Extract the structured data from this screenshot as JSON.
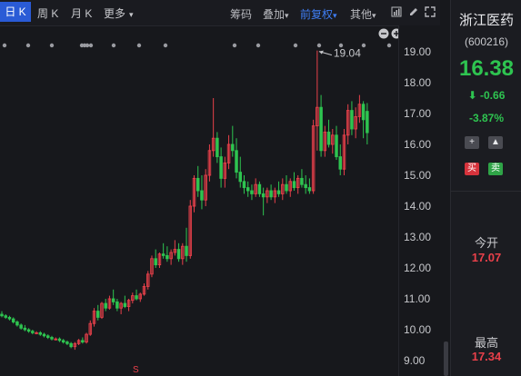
{
  "periods": [
    {
      "label": "日 K"
    },
    {
      "label": "周 K"
    },
    {
      "label": "月 K"
    },
    {
      "label": "更多"
    }
  ],
  "toolbar": {
    "chips": "筹码",
    "overlay": "叠加",
    "adjust": "前复权",
    "other": "其他"
  },
  "annotations": {
    "peak_label": "19.04",
    "marker": "S"
  },
  "stock": {
    "name": "浙江医药",
    "code": "(600216)",
    "price": "16.38",
    "change": "-0.66",
    "change_pct": "-3.87%",
    "buy_label": "买",
    "sell_label": "卖",
    "stats": [
      {
        "label": "今开",
        "value": "17.07"
      },
      {
        "label": "最高",
        "value": "17.34"
      }
    ]
  },
  "colors": {
    "up": "#e8404a",
    "down": "#2ec450",
    "accent": "#2a5bd6",
    "background": "#17181c"
  },
  "chart_data": {
    "type": "candlestick",
    "y_ticks": [
      "19.00",
      "18.00",
      "17.00",
      "16.00",
      "15.00",
      "14.00",
      "13.00",
      "12.00",
      "11.00",
      "10.00",
      "9.00"
    ],
    "ylim": [
      8.9,
      19.2
    ],
    "candles": [
      {
        "o": 10.5,
        "h": 10.6,
        "l": 10.4,
        "c": 10.45
      },
      {
        "o": 10.45,
        "h": 10.5,
        "l": 10.35,
        "c": 10.4
      },
      {
        "o": 10.4,
        "h": 10.45,
        "l": 10.3,
        "c": 10.35
      },
      {
        "o": 10.35,
        "h": 10.4,
        "l": 10.2,
        "c": 10.25
      },
      {
        "o": 10.25,
        "h": 10.3,
        "l": 10.1,
        "c": 10.15
      },
      {
        "o": 10.15,
        "h": 10.2,
        "l": 10.0,
        "c": 10.05
      },
      {
        "o": 10.05,
        "h": 10.15,
        "l": 9.95,
        "c": 10.0
      },
      {
        "o": 10.0,
        "h": 10.05,
        "l": 9.9,
        "c": 9.95
      },
      {
        "o": 9.95,
        "h": 10.0,
        "l": 9.85,
        "c": 9.9
      },
      {
        "o": 9.9,
        "h": 9.95,
        "l": 9.85,
        "c": 9.9
      },
      {
        "o": 9.9,
        "h": 9.95,
        "l": 9.8,
        "c": 9.85
      },
      {
        "o": 9.85,
        "h": 9.9,
        "l": 9.75,
        "c": 9.8
      },
      {
        "o": 9.8,
        "h": 9.85,
        "l": 9.7,
        "c": 9.75
      },
      {
        "o": 9.75,
        "h": 9.8,
        "l": 9.65,
        "c": 9.7
      },
      {
        "o": 9.7,
        "h": 9.75,
        "l": 9.65,
        "c": 9.7
      },
      {
        "o": 9.7,
        "h": 9.75,
        "l": 9.6,
        "c": 9.65
      },
      {
        "o": 9.65,
        "h": 9.7,
        "l": 9.55,
        "c": 9.6
      },
      {
        "o": 9.6,
        "h": 9.65,
        "l": 9.5,
        "c": 9.55
      },
      {
        "o": 9.55,
        "h": 9.6,
        "l": 9.4,
        "c": 9.45
      },
      {
        "o": 9.45,
        "h": 9.6,
        "l": 9.35,
        "c": 9.55
      },
      {
        "o": 9.55,
        "h": 9.7,
        "l": 9.5,
        "c": 9.65
      },
      {
        "o": 9.65,
        "h": 9.75,
        "l": 9.55,
        "c": 9.6
      },
      {
        "o": 9.6,
        "h": 9.9,
        "l": 9.55,
        "c": 9.85
      },
      {
        "o": 9.85,
        "h": 10.3,
        "l": 9.8,
        "c": 10.2
      },
      {
        "o": 10.2,
        "h": 10.7,
        "l": 10.1,
        "c": 10.6
      },
      {
        "o": 10.6,
        "h": 10.8,
        "l": 10.3,
        "c": 10.4
      },
      {
        "o": 10.4,
        "h": 10.9,
        "l": 10.35,
        "c": 10.85
      },
      {
        "o": 10.85,
        "h": 11.0,
        "l": 10.6,
        "c": 10.7
      },
      {
        "o": 10.7,
        "h": 11.1,
        "l": 10.65,
        "c": 11.0
      },
      {
        "o": 11.0,
        "h": 11.3,
        "l": 10.8,
        "c": 10.9
      },
      {
        "o": 10.9,
        "h": 11.0,
        "l": 10.6,
        "c": 10.7
      },
      {
        "o": 10.7,
        "h": 10.9,
        "l": 10.5,
        "c": 10.85
      },
      {
        "o": 10.85,
        "h": 11.1,
        "l": 10.7,
        "c": 10.75
      },
      {
        "o": 10.75,
        "h": 11.0,
        "l": 10.6,
        "c": 10.95
      },
      {
        "o": 10.95,
        "h": 11.2,
        "l": 10.85,
        "c": 11.1
      },
      {
        "o": 11.1,
        "h": 11.3,
        "l": 10.95,
        "c": 11.0
      },
      {
        "o": 11.0,
        "h": 11.2,
        "l": 10.9,
        "c": 11.15
      },
      {
        "o": 11.15,
        "h": 11.5,
        "l": 11.1,
        "c": 11.4
      },
      {
        "o": 11.4,
        "h": 11.9,
        "l": 11.3,
        "c": 11.8
      },
      {
        "o": 11.8,
        "h": 12.4,
        "l": 11.7,
        "c": 12.3
      },
      {
        "o": 12.3,
        "h": 12.6,
        "l": 12.0,
        "c": 12.1
      },
      {
        "o": 12.1,
        "h": 12.5,
        "l": 12.0,
        "c": 12.45
      },
      {
        "o": 12.45,
        "h": 12.8,
        "l": 12.3,
        "c": 12.4
      },
      {
        "o": 12.4,
        "h": 12.7,
        "l": 12.2,
        "c": 12.3
      },
      {
        "o": 12.3,
        "h": 12.6,
        "l": 12.1,
        "c": 12.5
      },
      {
        "o": 12.5,
        "h": 12.9,
        "l": 12.4,
        "c": 12.6
      },
      {
        "o": 12.6,
        "h": 12.8,
        "l": 12.2,
        "c": 12.3
      },
      {
        "o": 12.3,
        "h": 12.8,
        "l": 12.1,
        "c": 12.7
      },
      {
        "o": 12.7,
        "h": 13.3,
        "l": 12.2,
        "c": 12.4
      },
      {
        "o": 12.4,
        "h": 14.2,
        "l": 12.3,
        "c": 14.0
      },
      {
        "o": 14.0,
        "h": 15.0,
        "l": 13.8,
        "c": 14.9
      },
      {
        "o": 14.9,
        "h": 15.3,
        "l": 14.3,
        "c": 14.5
      },
      {
        "o": 14.5,
        "h": 15.0,
        "l": 13.9,
        "c": 14.2
      },
      {
        "o": 14.2,
        "h": 15.2,
        "l": 14.0,
        "c": 15.0
      },
      {
        "o": 15.0,
        "h": 16.0,
        "l": 14.8,
        "c": 15.8
      },
      {
        "o": 15.8,
        "h": 17.5,
        "l": 15.6,
        "c": 16.2
      },
      {
        "o": 16.2,
        "h": 16.4,
        "l": 15.4,
        "c": 15.6
      },
      {
        "o": 15.6,
        "h": 15.9,
        "l": 14.6,
        "c": 14.9
      },
      {
        "o": 14.9,
        "h": 15.6,
        "l": 14.6,
        "c": 15.4
      },
      {
        "o": 15.4,
        "h": 16.3,
        "l": 15.2,
        "c": 16.0
      },
      {
        "o": 16.0,
        "h": 16.6,
        "l": 15.6,
        "c": 15.8
      },
      {
        "o": 15.8,
        "h": 16.2,
        "l": 14.9,
        "c": 15.1
      },
      {
        "o": 15.1,
        "h": 15.6,
        "l": 14.6,
        "c": 14.8
      },
      {
        "o": 14.8,
        "h": 15.0,
        "l": 14.4,
        "c": 14.6
      },
      {
        "o": 14.6,
        "h": 14.8,
        "l": 14.3,
        "c": 14.5
      },
      {
        "o": 14.5,
        "h": 14.7,
        "l": 14.2,
        "c": 14.4
      },
      {
        "o": 14.4,
        "h": 14.9,
        "l": 14.3,
        "c": 14.7
      },
      {
        "o": 14.7,
        "h": 14.8,
        "l": 14.3,
        "c": 14.4
      },
      {
        "o": 14.4,
        "h": 14.6,
        "l": 13.7,
        "c": 14.3
      },
      {
        "o": 14.3,
        "h": 14.6,
        "l": 14.1,
        "c": 14.5
      },
      {
        "o": 14.5,
        "h": 14.7,
        "l": 14.2,
        "c": 14.3
      },
      {
        "o": 14.3,
        "h": 14.6,
        "l": 14.1,
        "c": 14.5
      },
      {
        "o": 14.5,
        "h": 14.8,
        "l": 14.3,
        "c": 14.4
      },
      {
        "o": 14.4,
        "h": 14.9,
        "l": 14.2,
        "c": 14.7
      },
      {
        "o": 14.7,
        "h": 15.0,
        "l": 14.4,
        "c": 14.5
      },
      {
        "o": 14.5,
        "h": 14.9,
        "l": 14.3,
        "c": 14.8
      },
      {
        "o": 14.8,
        "h": 15.1,
        "l": 14.5,
        "c": 14.6
      },
      {
        "o": 14.6,
        "h": 15.0,
        "l": 14.4,
        "c": 14.9
      },
      {
        "o": 14.9,
        "h": 15.2,
        "l": 14.6,
        "c": 14.7
      },
      {
        "o": 14.7,
        "h": 15.0,
        "l": 14.4,
        "c": 14.6
      },
      {
        "o": 14.6,
        "h": 14.9,
        "l": 14.4,
        "c": 14.5
      },
      {
        "o": 14.5,
        "h": 16.8,
        "l": 14.4,
        "c": 16.6
      },
      {
        "o": 16.6,
        "h": 19.04,
        "l": 15.8,
        "c": 17.2
      },
      {
        "o": 17.2,
        "h": 17.6,
        "l": 15.6,
        "c": 15.8
      },
      {
        "o": 15.8,
        "h": 16.6,
        "l": 15.6,
        "c": 16.4
      },
      {
        "o": 16.4,
        "h": 16.8,
        "l": 15.9,
        "c": 16.0
      },
      {
        "o": 16.0,
        "h": 16.5,
        "l": 15.7,
        "c": 16.3
      },
      {
        "o": 16.3,
        "h": 16.6,
        "l": 15.5,
        "c": 15.6
      },
      {
        "o": 15.6,
        "h": 16.0,
        "l": 15.0,
        "c": 15.2
      },
      {
        "o": 15.2,
        "h": 16.5,
        "l": 15.0,
        "c": 16.3
      },
      {
        "o": 16.3,
        "h": 17.3,
        "l": 16.0,
        "c": 17.1
      },
      {
        "o": 17.1,
        "h": 17.4,
        "l": 16.3,
        "c": 16.5
      },
      {
        "o": 16.5,
        "h": 17.2,
        "l": 16.2,
        "c": 16.9
      },
      {
        "o": 16.9,
        "h": 17.6,
        "l": 16.7,
        "c": 17.3
      },
      {
        "o": 17.3,
        "h": 17.4,
        "l": 16.2,
        "c": 16.8
      },
      {
        "o": 17.07,
        "h": 17.34,
        "l": 16.0,
        "c": 16.38
      }
    ]
  }
}
